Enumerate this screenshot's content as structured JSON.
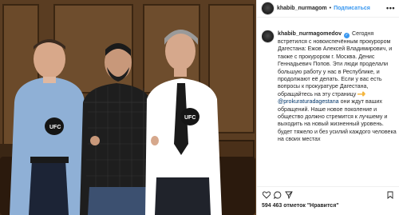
{
  "post": {
    "username": "khabib_nurmagom",
    "follow_label": "Подписаться",
    "more_label": "•••",
    "caption_username": "khabib_nurmagomedov",
    "caption_verified_icon": "verified-badge-icon",
    "caption_text_1": "Сегодня встретился с новоиспечённым прокурором Дагестана: Ежов Алексей Владимирович, и также с прокурором г. Москва. Денис Геннадьевич Попов. Эти люди проделали большую работу у нас в Республике, и продолжают её делать. Если у вас есть вопросы к прокуратуре Дагестана, обращайтесь на эту страницу",
    "caption_mention": "@prokuraturadagestana",
    "caption_text_2": "они ждут ваших обращений. Наше новое поколение и общество должно стремится к лучшему и выходить на новый жизненный уровень. будет тяжело и без усилий каждого человека на своих местах",
    "likes_text": "594 463 отметок \"Нравится\"",
    "actions": [
      "heart-icon",
      "comment-icon",
      "share-icon",
      "bookmark-icon"
    ]
  },
  "photo": {
    "description_icon": "post-photo",
    "glove_text": "UFC"
  },
  "colors": {
    "accent": "#3897f0",
    "text": "#262626",
    "border": "#efefef"
  }
}
